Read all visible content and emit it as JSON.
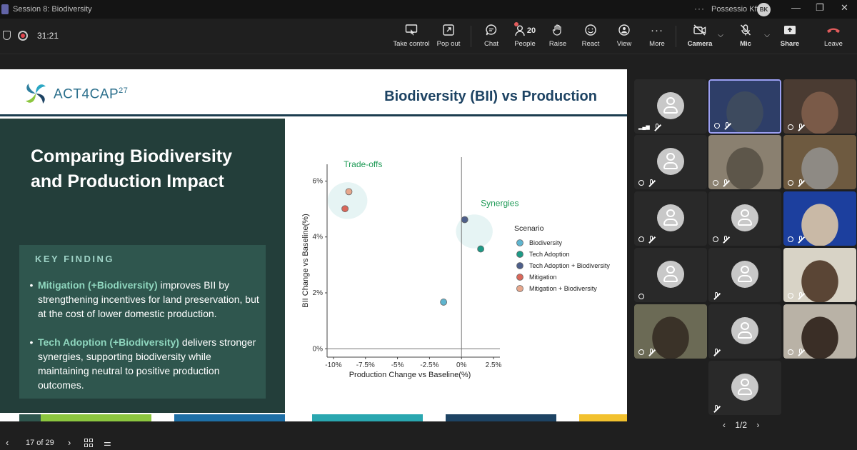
{
  "window": {
    "title": "Session 8: Biodiversity",
    "org": "Possessio Kft",
    "user_initials": "BK",
    "min_label": "—",
    "restore_label": "❐",
    "close_label": "✕"
  },
  "toolbar": {
    "timer": "31:21",
    "buttons": {
      "take_control": "Take control",
      "pop_out": "Pop out",
      "chat": "Chat",
      "people": "People",
      "people_count": "20",
      "raise": "Raise",
      "react": "React",
      "view": "View",
      "more": "More",
      "camera": "Camera",
      "mic": "Mic",
      "share": "Share",
      "leave": "Leave"
    }
  },
  "slide": {
    "logo_text": "ACT4CAP",
    "logo_sup": "27",
    "title": "Biodiversity (BII) vs Production",
    "left_title": "Comparing Biodiversity and Production Impact",
    "key_finding_label": "KEY FINDING",
    "findings": [
      {
        "highlight": "Mitigation (+Biodiversity)",
        "text": " improves BII by strengthening incentives for land preservation, but at the cost of lower domestic production."
      },
      {
        "highlight": "Tech Adoption (+Biodiversity)",
        "text": " delivers stronger synergies, supporting biodiversity while maintaining neutral to positive production outcomes."
      }
    ]
  },
  "chart_data": {
    "type": "scatter",
    "xlabel": "Production Change vs Baseline(%)",
    "ylabel": "BII Change vs Baseline(%)",
    "xlim": [
      -10.5,
      3
    ],
    "ylim": [
      -0.3,
      6.6
    ],
    "x_ticks": [
      "-10%",
      "-7.5%",
      "-5%",
      "-2.5%",
      "0%",
      "2.5%"
    ],
    "x_tick_values": [
      -10,
      -7.5,
      -5,
      -2.5,
      0,
      2.5
    ],
    "y_ticks": [
      "0%",
      "2%",
      "4%",
      "6%"
    ],
    "y_tick_values": [
      0,
      2,
      4,
      6
    ],
    "legend_title": "Scenario",
    "legend_position": "right",
    "annotations": [
      {
        "text": "Trade-offs",
        "x": -9.2,
        "y": 6.5
      },
      {
        "text": "Synergies",
        "x": 1.5,
        "y": 5.1
      }
    ],
    "highlight_regions": [
      {
        "label": "Trade-offs",
        "cx": -8.9,
        "cy": 5.3,
        "r": 2.2
      },
      {
        "label": "Synergies",
        "cx": 1.0,
        "cy": 4.2,
        "r": 2.0
      }
    ],
    "series": [
      {
        "name": "Biodiversity",
        "color": "#5fb5cf",
        "points": [
          {
            "x": -1.4,
            "y": 1.67
          }
        ]
      },
      {
        "name": "Tech Adoption",
        "color": "#1e9a86",
        "points": [
          {
            "x": 1.5,
            "y": 3.57
          }
        ]
      },
      {
        "name": "Tech Adoption + Biodiversity",
        "color": "#4e5f8a",
        "points": [
          {
            "x": 0.25,
            "y": 4.62
          }
        ]
      },
      {
        "name": "Mitigation",
        "color": "#d9675a",
        "points": [
          {
            "x": -9.1,
            "y": 5.01
          }
        ]
      },
      {
        "name": "Mitigation + Biodiversity",
        "color": "#e7a78c",
        "points": [
          {
            "x": -8.8,
            "y": 5.62
          }
        ]
      }
    ]
  },
  "slide_nav": {
    "position": "17 of 29"
  },
  "gallery": {
    "pager": "1/2"
  }
}
